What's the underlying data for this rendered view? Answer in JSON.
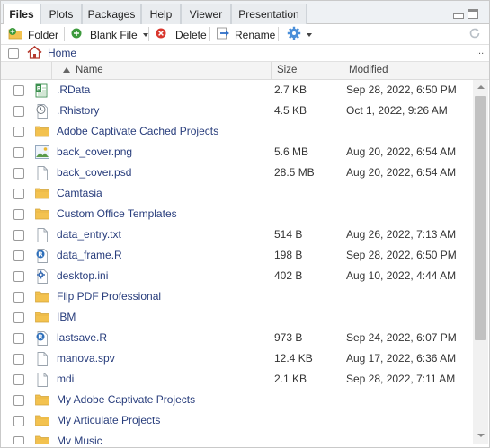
{
  "tabs": [
    {
      "label": "Files",
      "active": true
    },
    {
      "label": "Plots",
      "active": false
    },
    {
      "label": "Packages",
      "active": false
    },
    {
      "label": "Help",
      "active": false
    },
    {
      "label": "Viewer",
      "active": false
    },
    {
      "label": "Presentation",
      "active": false
    }
  ],
  "toolbar": {
    "new_folder_label": "Folder",
    "blank_file_label": "Blank File",
    "delete_label": "Delete",
    "rename_label": "Rename",
    "more_icon": "gear-icon",
    "refresh_icon": "refresh-icon"
  },
  "path": {
    "home_label": "Home",
    "more_label": "..."
  },
  "columns": {
    "name": "Name",
    "size": "Size",
    "modified": "Modified",
    "sort": "ascending-by-name"
  },
  "files": [
    {
      "name": ".RData",
      "size": "2.7 KB",
      "modified": "Sep 28, 2022, 6:50 PM",
      "icon": "rdata-icon"
    },
    {
      "name": ".Rhistory",
      "size": "4.5 KB",
      "modified": "Oct 1, 2022, 9:26 AM",
      "icon": "history-icon"
    },
    {
      "name": "Adobe Captivate Cached Projects",
      "size": "",
      "modified": "",
      "icon": "folder-icon"
    },
    {
      "name": "back_cover.png",
      "size": "5.6 MB",
      "modified": "Aug 20, 2022, 6:54 AM",
      "icon": "image-icon"
    },
    {
      "name": "back_cover.psd",
      "size": "28.5 MB",
      "modified": "Aug 20, 2022, 6:54 AM",
      "icon": "file-icon"
    },
    {
      "name": "Camtasia",
      "size": "",
      "modified": "",
      "icon": "folder-icon"
    },
    {
      "name": "Custom Office Templates",
      "size": "",
      "modified": "",
      "icon": "folder-icon"
    },
    {
      "name": "data_entry.txt",
      "size": "514 B",
      "modified": "Aug 26, 2022, 7:13 AM",
      "icon": "file-icon"
    },
    {
      "name": "data_frame.R",
      "size": "198 B",
      "modified": "Sep 28, 2022, 6:50 PM",
      "icon": "r-script-icon"
    },
    {
      "name": "desktop.ini",
      "size": "402 B",
      "modified": "Aug 10, 2022, 4:44 AM",
      "icon": "settings-file-icon"
    },
    {
      "name": "Flip PDF Professional",
      "size": "",
      "modified": "",
      "icon": "folder-icon"
    },
    {
      "name": "IBM",
      "size": "",
      "modified": "",
      "icon": "folder-icon"
    },
    {
      "name": "lastsave.R",
      "size": "973 B",
      "modified": "Sep 24, 2022, 6:07 PM",
      "icon": "r-script-icon"
    },
    {
      "name": "manova.spv",
      "size": "12.4 KB",
      "modified": "Aug 17, 2022, 6:36 AM",
      "icon": "file-icon"
    },
    {
      "name": "mdi",
      "size": "2.1 KB",
      "modified": "Sep 28, 2022, 7:11 AM",
      "icon": "file-icon"
    },
    {
      "name": "My Adobe Captivate Projects",
      "size": "",
      "modified": "",
      "icon": "folder-icon"
    },
    {
      "name": "My Articulate Projects",
      "size": "",
      "modified": "",
      "icon": "folder-icon"
    },
    {
      "name": "My Music",
      "size": "",
      "modified": "",
      "icon": "folder-icon"
    }
  ],
  "colors": {
    "link": "#283d7c",
    "folder": "#f3c24f",
    "delete_red": "#d9372e",
    "add_green": "#3c9a3c"
  }
}
